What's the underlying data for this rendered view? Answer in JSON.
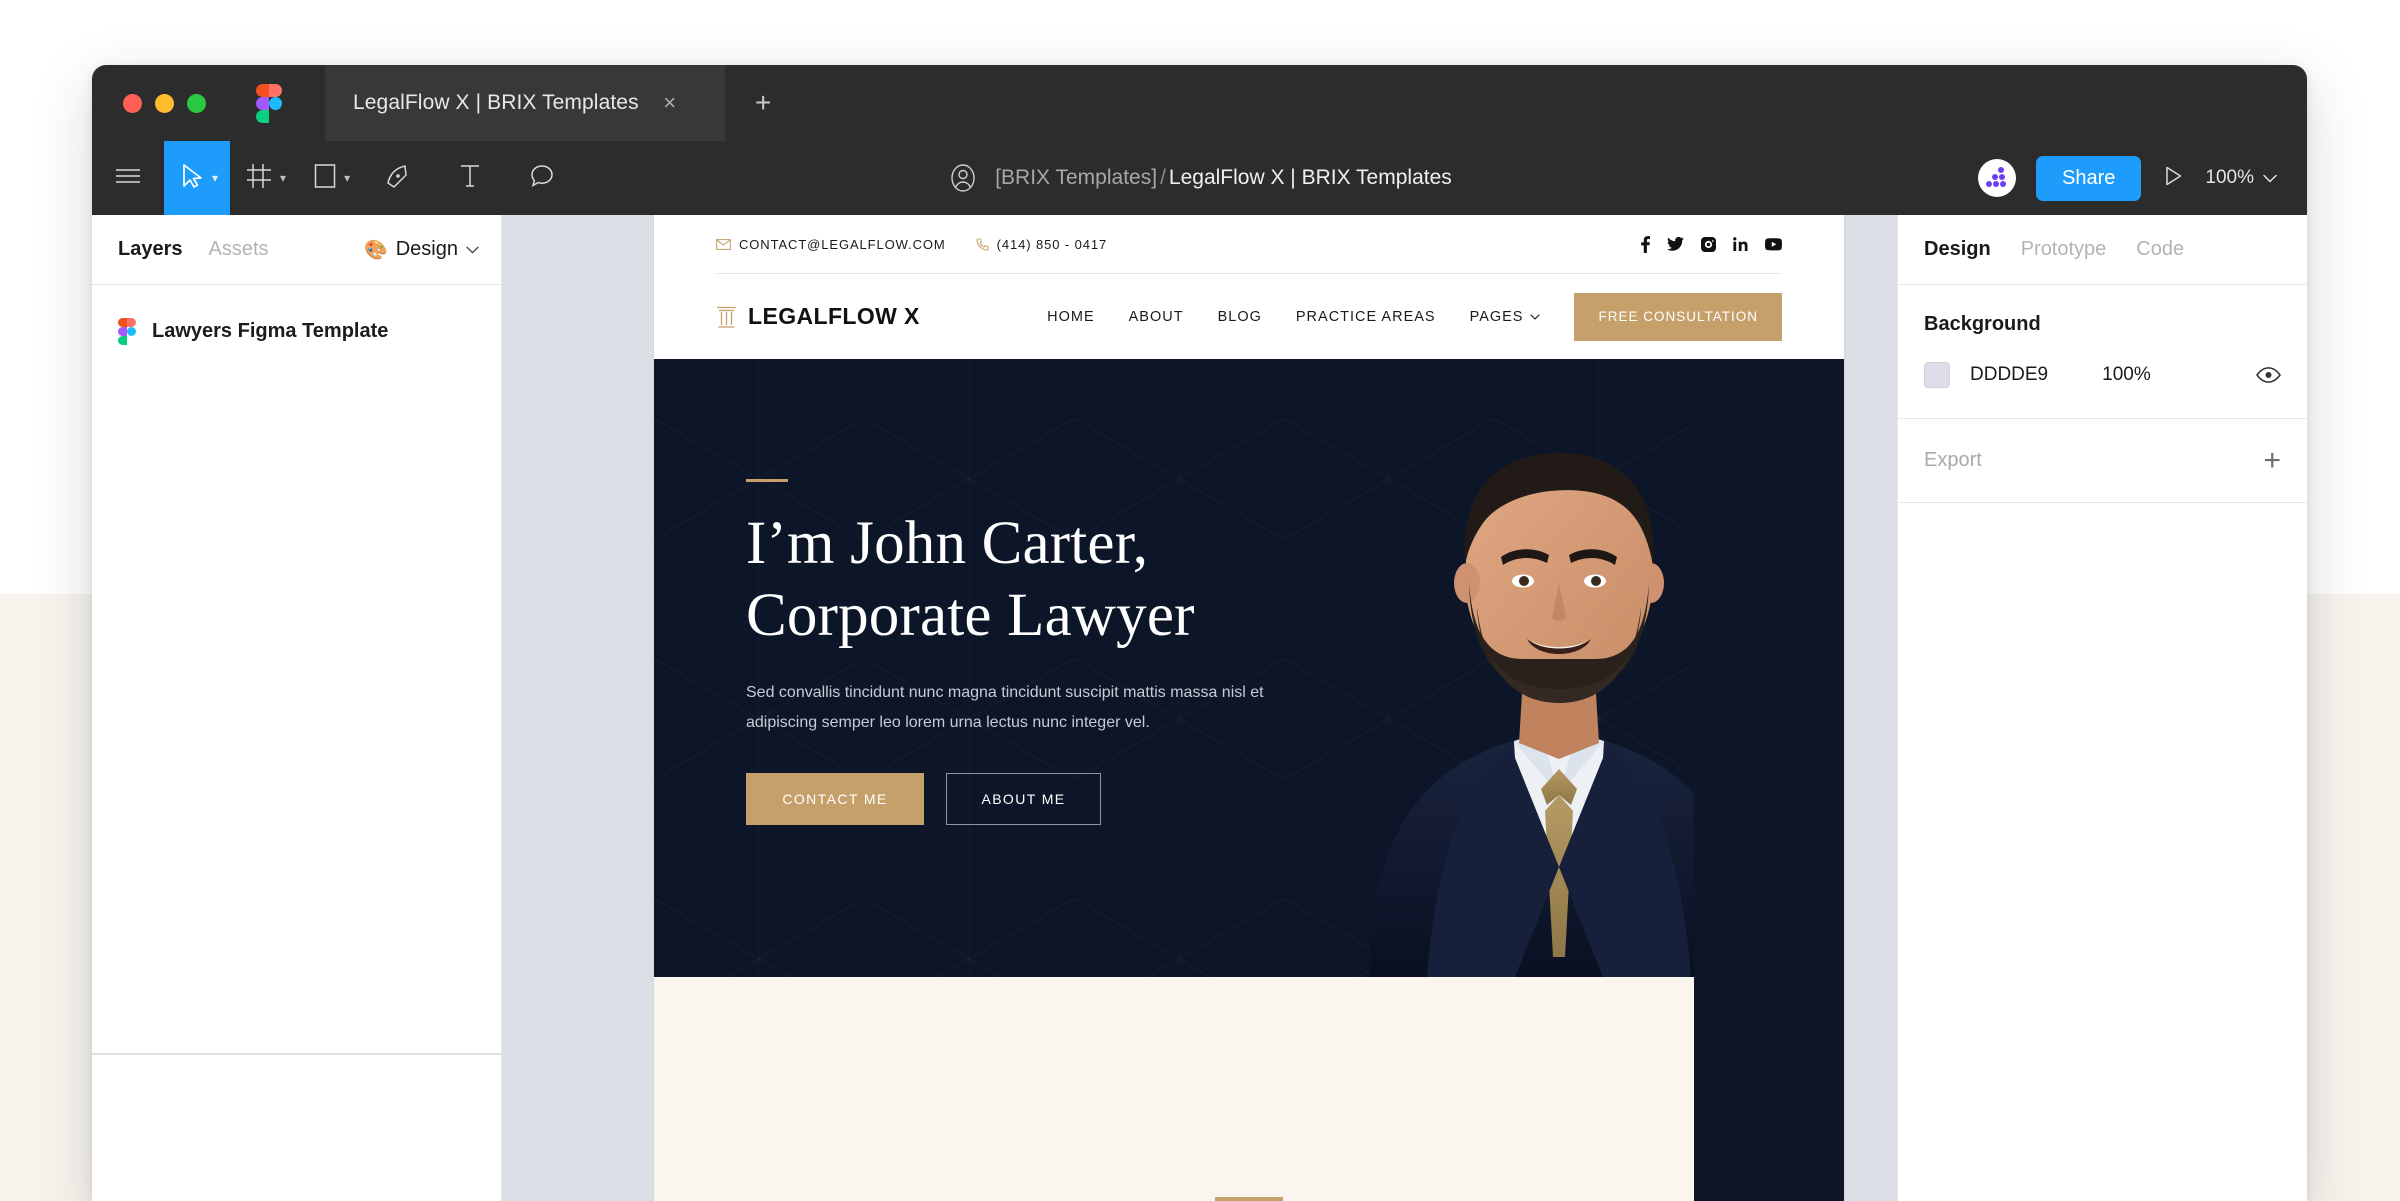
{
  "window": {
    "traffic_lights": [
      "close",
      "minimize",
      "maximize"
    ],
    "tab_title": "LegalFlow X | BRIX Templates",
    "tab_close": "×",
    "new_tab": "+"
  },
  "toolbar": {
    "tools": [
      {
        "name": "main-menu",
        "icon": "hamburger-menu-icon"
      },
      {
        "name": "move-tool",
        "icon": "cursor-arrow-icon",
        "active": true
      },
      {
        "name": "frame-tool",
        "icon": "frame-icon"
      },
      {
        "name": "shape-tool",
        "icon": "rectangle-icon"
      },
      {
        "name": "pen-tool",
        "icon": "pen-icon"
      },
      {
        "name": "text-tool",
        "icon": "text-t-icon"
      },
      {
        "name": "comment-tool",
        "icon": "comment-bubble-icon"
      }
    ],
    "breadcrumb_team": "[BRIX Templates]",
    "breadcrumb_separator": "/",
    "breadcrumb_file": "LegalFlow X | BRIX Templates",
    "share_label": "Share",
    "present_icon": "play-triangle-icon",
    "zoom_level": "100%",
    "zoom_chevron": "∨"
  },
  "left_panel": {
    "tabs": [
      {
        "label": "Layers",
        "active": true
      },
      {
        "label": "Assets",
        "active": false
      }
    ],
    "design_menu": {
      "icon": "🎨",
      "label": "Design",
      "chevron": "∨"
    },
    "layers": [
      {
        "name": "Lawyers Figma Template",
        "icon": "figma-file-icon"
      }
    ]
  },
  "right_panel": {
    "tabs": [
      {
        "label": "Design",
        "active": true
      },
      {
        "label": "Prototype",
        "active": false
      },
      {
        "label": "Code",
        "active": false
      }
    ],
    "background": {
      "title": "Background",
      "hex": "DDDDE9",
      "opacity": "100%",
      "swatch_color": "#DDDDE9",
      "visibility_icon": "eye-icon"
    },
    "export": {
      "title": "Export",
      "add_icon": "+"
    }
  },
  "canvas": {
    "site": {
      "topbar": {
        "email": "CONTACT@LEGALFLOW.COM",
        "email_icon": "envelope-icon",
        "phone": "(414) 850 - 0417",
        "phone_icon": "phone-icon",
        "socials": [
          "facebook-icon",
          "twitter-icon",
          "instagram-icon",
          "linkedin-icon",
          "youtube-icon"
        ]
      },
      "brand": {
        "logo_icon": "pillar-icon",
        "name": "LEGALFLOW X"
      },
      "nav": [
        {
          "label": "HOME"
        },
        {
          "label": "ABOUT"
        },
        {
          "label": "BLOG"
        },
        {
          "label": "PRACTICE AREAS"
        },
        {
          "label": "PAGES",
          "has_dropdown": true
        }
      ],
      "cta": "FREE CONSULTATION",
      "hero": {
        "title_line1": "I’m John Carter,",
        "title_line2": "Corporate Lawyer",
        "subtitle": "Sed convallis tincidunt nunc magna tincidunt suscipit mattis massa nisl et adipiscing semper leo lorem urna lectus nunc integer vel.",
        "primary_button": "CONTACT ME",
        "secondary_button": "ABOUT ME",
        "background_color": "#0D1628",
        "accent_color": "#C5A06A",
        "portrait_alt": "portrait of smiling bearded man in navy suit with gold tie"
      }
    }
  },
  "colors": {
    "accent_blue": "#1E9CFB",
    "chrome_dark": "#2C2C2C",
    "tab_dark": "#383838",
    "page_cream": "#F7F4ED",
    "canvas_gray": "#DCDEE6",
    "site_gold": "#C5A06A",
    "site_navy": "#0D1628"
  }
}
